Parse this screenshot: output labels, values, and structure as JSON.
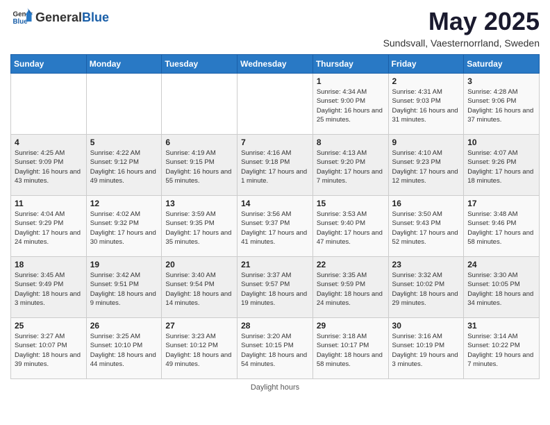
{
  "logo": {
    "general": "General",
    "blue": "Blue"
  },
  "title": "May 2025",
  "subtitle": "Sundsvall, Vaesternorrland, Sweden",
  "days_of_week": [
    "Sunday",
    "Monday",
    "Tuesday",
    "Wednesday",
    "Thursday",
    "Friday",
    "Saturday"
  ],
  "footer": "Daylight hours",
  "weeks": [
    [
      {
        "day": "",
        "info": ""
      },
      {
        "day": "",
        "info": ""
      },
      {
        "day": "",
        "info": ""
      },
      {
        "day": "",
        "info": ""
      },
      {
        "day": "1",
        "info": "Sunrise: 4:34 AM\nSunset: 9:00 PM\nDaylight: 16 hours and 25 minutes."
      },
      {
        "day": "2",
        "info": "Sunrise: 4:31 AM\nSunset: 9:03 PM\nDaylight: 16 hours and 31 minutes."
      },
      {
        "day": "3",
        "info": "Sunrise: 4:28 AM\nSunset: 9:06 PM\nDaylight: 16 hours and 37 minutes."
      }
    ],
    [
      {
        "day": "4",
        "info": "Sunrise: 4:25 AM\nSunset: 9:09 PM\nDaylight: 16 hours and 43 minutes."
      },
      {
        "day": "5",
        "info": "Sunrise: 4:22 AM\nSunset: 9:12 PM\nDaylight: 16 hours and 49 minutes."
      },
      {
        "day": "6",
        "info": "Sunrise: 4:19 AM\nSunset: 9:15 PM\nDaylight: 16 hours and 55 minutes."
      },
      {
        "day": "7",
        "info": "Sunrise: 4:16 AM\nSunset: 9:18 PM\nDaylight: 17 hours and 1 minute."
      },
      {
        "day": "8",
        "info": "Sunrise: 4:13 AM\nSunset: 9:20 PM\nDaylight: 17 hours and 7 minutes."
      },
      {
        "day": "9",
        "info": "Sunrise: 4:10 AM\nSunset: 9:23 PM\nDaylight: 17 hours and 12 minutes."
      },
      {
        "day": "10",
        "info": "Sunrise: 4:07 AM\nSunset: 9:26 PM\nDaylight: 17 hours and 18 minutes."
      }
    ],
    [
      {
        "day": "11",
        "info": "Sunrise: 4:04 AM\nSunset: 9:29 PM\nDaylight: 17 hours and 24 minutes."
      },
      {
        "day": "12",
        "info": "Sunrise: 4:02 AM\nSunset: 9:32 PM\nDaylight: 17 hours and 30 minutes."
      },
      {
        "day": "13",
        "info": "Sunrise: 3:59 AM\nSunset: 9:35 PM\nDaylight: 17 hours and 35 minutes."
      },
      {
        "day": "14",
        "info": "Sunrise: 3:56 AM\nSunset: 9:37 PM\nDaylight: 17 hours and 41 minutes."
      },
      {
        "day": "15",
        "info": "Sunrise: 3:53 AM\nSunset: 9:40 PM\nDaylight: 17 hours and 47 minutes."
      },
      {
        "day": "16",
        "info": "Sunrise: 3:50 AM\nSunset: 9:43 PM\nDaylight: 17 hours and 52 minutes."
      },
      {
        "day": "17",
        "info": "Sunrise: 3:48 AM\nSunset: 9:46 PM\nDaylight: 17 hours and 58 minutes."
      }
    ],
    [
      {
        "day": "18",
        "info": "Sunrise: 3:45 AM\nSunset: 9:49 PM\nDaylight: 18 hours and 3 minutes."
      },
      {
        "day": "19",
        "info": "Sunrise: 3:42 AM\nSunset: 9:51 PM\nDaylight: 18 hours and 9 minutes."
      },
      {
        "day": "20",
        "info": "Sunrise: 3:40 AM\nSunset: 9:54 PM\nDaylight: 18 hours and 14 minutes."
      },
      {
        "day": "21",
        "info": "Sunrise: 3:37 AM\nSunset: 9:57 PM\nDaylight: 18 hours and 19 minutes."
      },
      {
        "day": "22",
        "info": "Sunrise: 3:35 AM\nSunset: 9:59 PM\nDaylight: 18 hours and 24 minutes."
      },
      {
        "day": "23",
        "info": "Sunrise: 3:32 AM\nSunset: 10:02 PM\nDaylight: 18 hours and 29 minutes."
      },
      {
        "day": "24",
        "info": "Sunrise: 3:30 AM\nSunset: 10:05 PM\nDaylight: 18 hours and 34 minutes."
      }
    ],
    [
      {
        "day": "25",
        "info": "Sunrise: 3:27 AM\nSunset: 10:07 PM\nDaylight: 18 hours and 39 minutes."
      },
      {
        "day": "26",
        "info": "Sunrise: 3:25 AM\nSunset: 10:10 PM\nDaylight: 18 hours and 44 minutes."
      },
      {
        "day": "27",
        "info": "Sunrise: 3:23 AM\nSunset: 10:12 PM\nDaylight: 18 hours and 49 minutes."
      },
      {
        "day": "28",
        "info": "Sunrise: 3:20 AM\nSunset: 10:15 PM\nDaylight: 18 hours and 54 minutes."
      },
      {
        "day": "29",
        "info": "Sunrise: 3:18 AM\nSunset: 10:17 PM\nDaylight: 18 hours and 58 minutes."
      },
      {
        "day": "30",
        "info": "Sunrise: 3:16 AM\nSunset: 10:19 PM\nDaylight: 19 hours and 3 minutes."
      },
      {
        "day": "31",
        "info": "Sunrise: 3:14 AM\nSunset: 10:22 PM\nDaylight: 19 hours and 7 minutes."
      }
    ]
  ]
}
